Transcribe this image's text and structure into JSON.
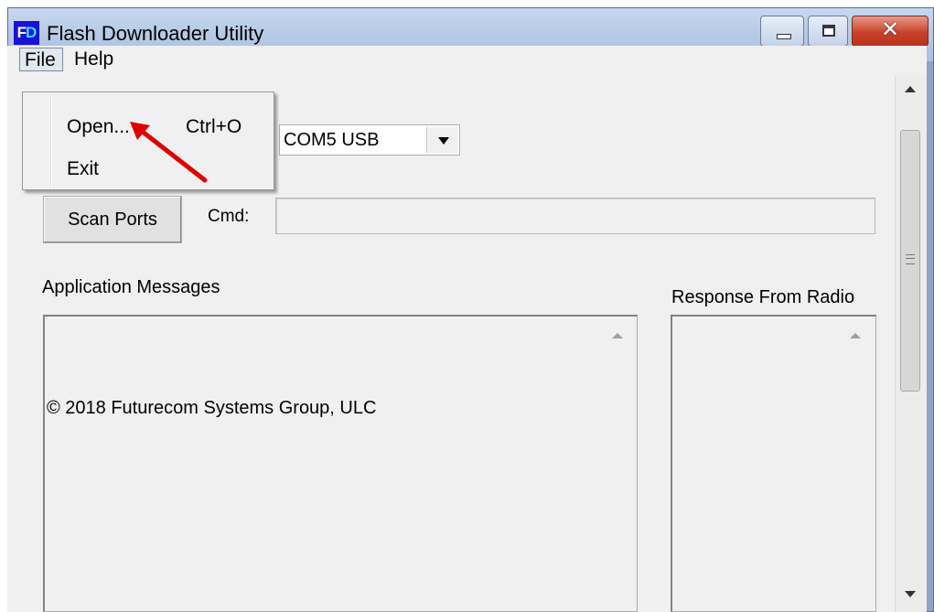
{
  "window": {
    "title": "Flash Downloader Utility",
    "icon_text": "FD",
    "icon_name": "app-icon",
    "controls": {
      "minimize": "minimize-icon",
      "maximize": "maximize-icon",
      "close": "close-icon",
      "close_glyph": "✕"
    }
  },
  "menubar": {
    "items": [
      {
        "label": "File"
      },
      {
        "label": "Help"
      }
    ]
  },
  "file_menu": {
    "items": [
      {
        "label": "Open...",
        "shortcut": "Ctrl+O"
      },
      {
        "label": "Exit",
        "shortcut": ""
      }
    ]
  },
  "port": {
    "selected": "COM5 USB"
  },
  "scan_button": {
    "label": "Scan Ports"
  },
  "cmd": {
    "label": "Cmd:",
    "value": ""
  },
  "app_messages": {
    "label": "Application Messages",
    "text": "© 2018 Futurecom Systems Group, ULC"
  },
  "radio_response": {
    "label": "Response From Radio",
    "text": ""
  },
  "annotation": {
    "arrow_color": "#e00000"
  }
}
